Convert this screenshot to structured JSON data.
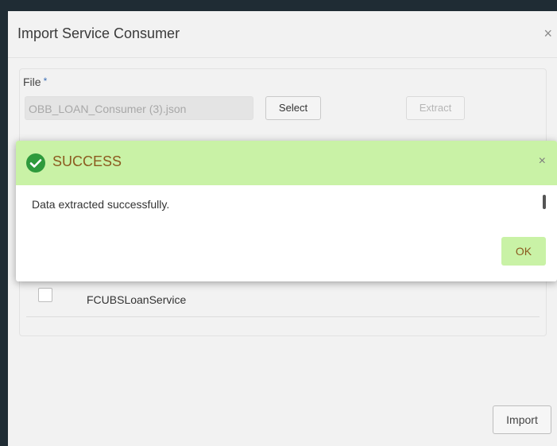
{
  "dialog": {
    "title": "Import Service Consumer",
    "close_glyph": "×"
  },
  "file_section": {
    "label": "File",
    "required_mark": "*",
    "file_name": "OBB_LOAN_Consumer (3).json",
    "select_label": "Select",
    "extract_label": "Extract"
  },
  "service_list": [
    {
      "label": "FCUBSLoanService",
      "checked": false
    }
  ],
  "footer": {
    "import_label": "Import"
  },
  "toast": {
    "title": "SUCCESS",
    "icon": "check-circle-icon",
    "close_glyph": "×",
    "message": "Data extracted successfully.",
    "ok_label": "OK",
    "header_color": "#c9f2a6",
    "title_color": "#8b5a1f",
    "icon_color": "#2e9a3c"
  }
}
